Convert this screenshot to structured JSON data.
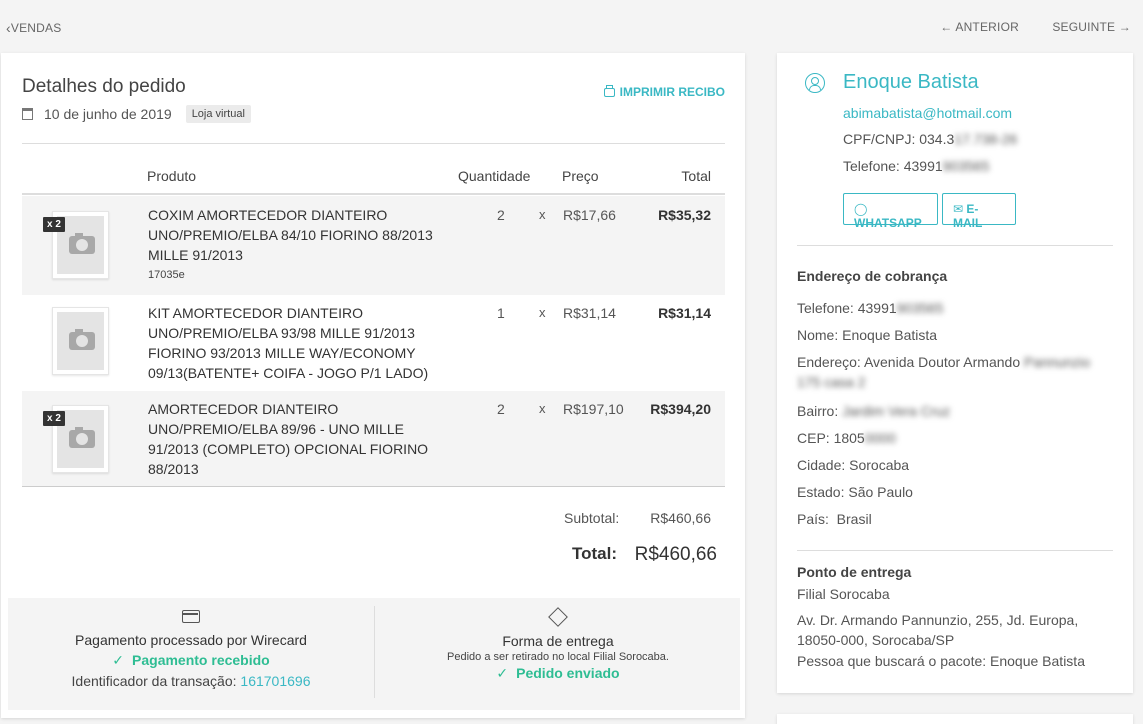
{
  "nav": {
    "back": "VENDAS",
    "previous": "ANTERIOR",
    "next": "SEGUINTE"
  },
  "order": {
    "title": "Detalhes do pedido",
    "date": "10 de junho de 2019",
    "badge": "Loja virtual",
    "print_label": "IMPRIMIR RECIBO",
    "columns": {
      "product": "Produto",
      "quantity": "Quantidade",
      "price": "Preço",
      "total": "Total"
    },
    "items": [
      {
        "badge": "x 2",
        "name": "COXIM AMORTECEDOR DIANTEIRO UNO/PREMIO/ELBA 84/10 FIORINO 88/2013 MILLE 91/2013",
        "sku": "17035e",
        "qty": "2",
        "times": "x",
        "price": "R$17,66",
        "total": "R$35,32"
      },
      {
        "badge": "",
        "name": "KIT AMORTECEDOR DIANTEIRO UNO/PREMIO/ELBA 93/98 MILLE 91/2013 FIORINO 93/2013 MILLE WAY/ECONOMY 09/13(BATENTE+ COIFA - JOGO P/1 LADO)",
        "sku": "",
        "qty": "1",
        "times": "x",
        "price": "R$31,14",
        "total": "R$31,14"
      },
      {
        "badge": "x 2",
        "name": "AMORTECEDOR DIANTEIRO UNO/PREMIO/ELBA 89/96 - UNO MILLE 91/2013 (COMPLETO) OPCIONAL FIORINO 88/2013",
        "sku": "",
        "qty": "2",
        "times": "x",
        "price": "R$197,10",
        "total": "R$394,20"
      }
    ],
    "subtotal_label": "Subtotal:",
    "subtotal_value": "R$460,66",
    "total_label": "Total:",
    "total_value": "R$460,66",
    "payment": {
      "title": "Pagamento processado por Wirecard",
      "status": "Pagamento recebido",
      "txn_label": "Identificador da transação:",
      "txn_id": "161701696"
    },
    "delivery": {
      "title": "Forma de entrega",
      "subtitle": "Pedido a ser retirado no local Filial Sorocaba.",
      "status": "Pedido enviado"
    }
  },
  "customer": {
    "name": "Enoque Batista",
    "email": "abimabatista@hotmail.com",
    "cpf_label": "CPF/CNPJ: 034.3",
    "cpf_hidden": "17.738-26",
    "phone_label": "Telefone: 43991",
    "phone_hidden": "903565",
    "whatsapp": "WHATSAPP",
    "email_btn": "E-MAIL",
    "billing": {
      "title": "Endereço de cobrança",
      "phone_label": "Telefone: 43991",
      "phone_hidden": "903565",
      "name": "Nome: Enoque Batista",
      "address_label": "Endereço: Avenida Doutor Armando",
      "address_hidden1": "Pannunzio",
      "address_hidden2": "175 casa 2",
      "district_label": "Bairro:",
      "district_hidden": "Jardim Vera Cruz",
      "cep_label": "CEP: 1805",
      "cep_hidden": "0000",
      "city": "Cidade: Sorocaba",
      "state": "Estado: São Paulo",
      "country": "País:  Brasil"
    },
    "pickup": {
      "title": "Ponto de entrega",
      "branch": "Filial Sorocaba",
      "address": "Av. Dr. Armando Pannunzio, 255, Jd. Europa, 18050-000, Sorocaba/SP",
      "person": "Pessoa que buscará o pacote: Enoque Batista"
    }
  },
  "colors": {
    "accent": "#3ab8c4",
    "success": "#2ebd93"
  }
}
